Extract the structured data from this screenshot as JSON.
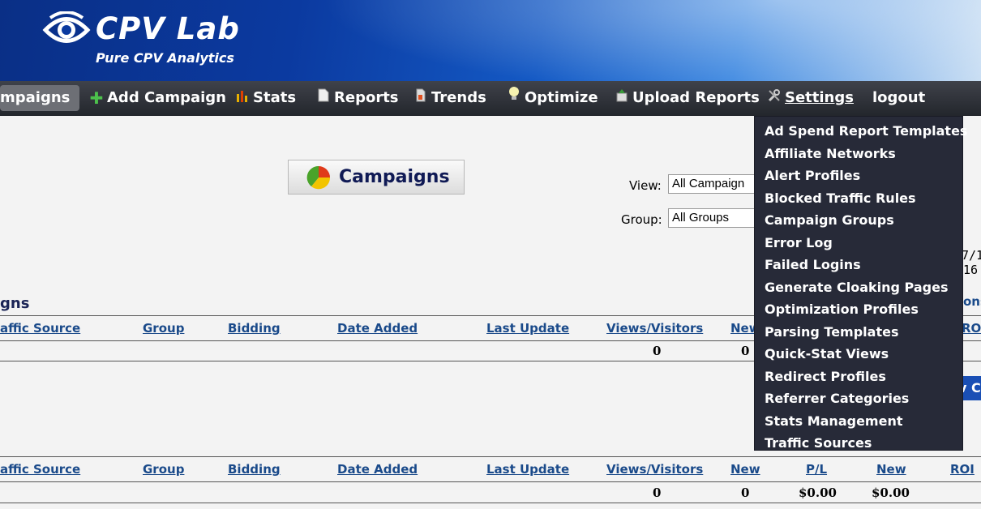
{
  "header": {
    "logo_title": "CPV Lab",
    "logo_subtitle": "Pure CPV Analytics"
  },
  "nav": {
    "campaigns": "mpaigns",
    "add_campaign": "Add Campaign",
    "stats": "Stats",
    "reports": "Reports",
    "trends": "Trends",
    "optimize": "Optimize",
    "upload_reports": "Upload Reports",
    "settings": "Settings",
    "logout": "logout"
  },
  "page": {
    "campaigns_button": "Campaigns",
    "view_label": "View:",
    "view_value": "All Campaign",
    "group_label": "Group:",
    "group_value": "All Groups",
    "section_title": "gns",
    "side_date_1": "7/1",
    "side_date_2": "16",
    "side_link": "ons",
    "side_button": "v C"
  },
  "table1": {
    "headers": {
      "traffic_source": "affic Source",
      "group": "Group",
      "bidding": "Bidding",
      "date_added": "Date Added",
      "last_update": "Last Update",
      "views_visitors": "Views/Visitors",
      "new": "New",
      "roi": "ROI"
    },
    "totals": {
      "views": "0",
      "new": "0"
    }
  },
  "table2": {
    "headers": {
      "traffic_source": "affic Source",
      "group": "Group",
      "bidding": "Bidding",
      "date_added": "Date Added",
      "last_update": "Last Update",
      "views_visitors": "Views/Visitors",
      "new": "New",
      "pl": "P/L",
      "new2": "New",
      "roi": "ROI"
    },
    "totals": {
      "views": "0",
      "new": "0",
      "pl": "$0.00",
      "new2": "$0.00"
    }
  },
  "settings_menu": {
    "items": [
      "Ad Spend Report Templates",
      "Affiliate Networks",
      "Alert Profiles",
      "Blocked Traffic Rules",
      "Campaign Groups",
      "Error Log",
      "Failed Logins",
      "Generate Cloaking Pages",
      "Optimization Profiles",
      "Parsing Templates",
      "Quick-Stat Views",
      "Redirect Profiles",
      "Referrer Categories",
      "Stats Management",
      "Traffic Sources"
    ]
  },
  "colors": {
    "nav_bg": "#2b2e35",
    "menu_bg": "#272a38",
    "link": "#1a4a8a",
    "accent": "#101a55"
  }
}
